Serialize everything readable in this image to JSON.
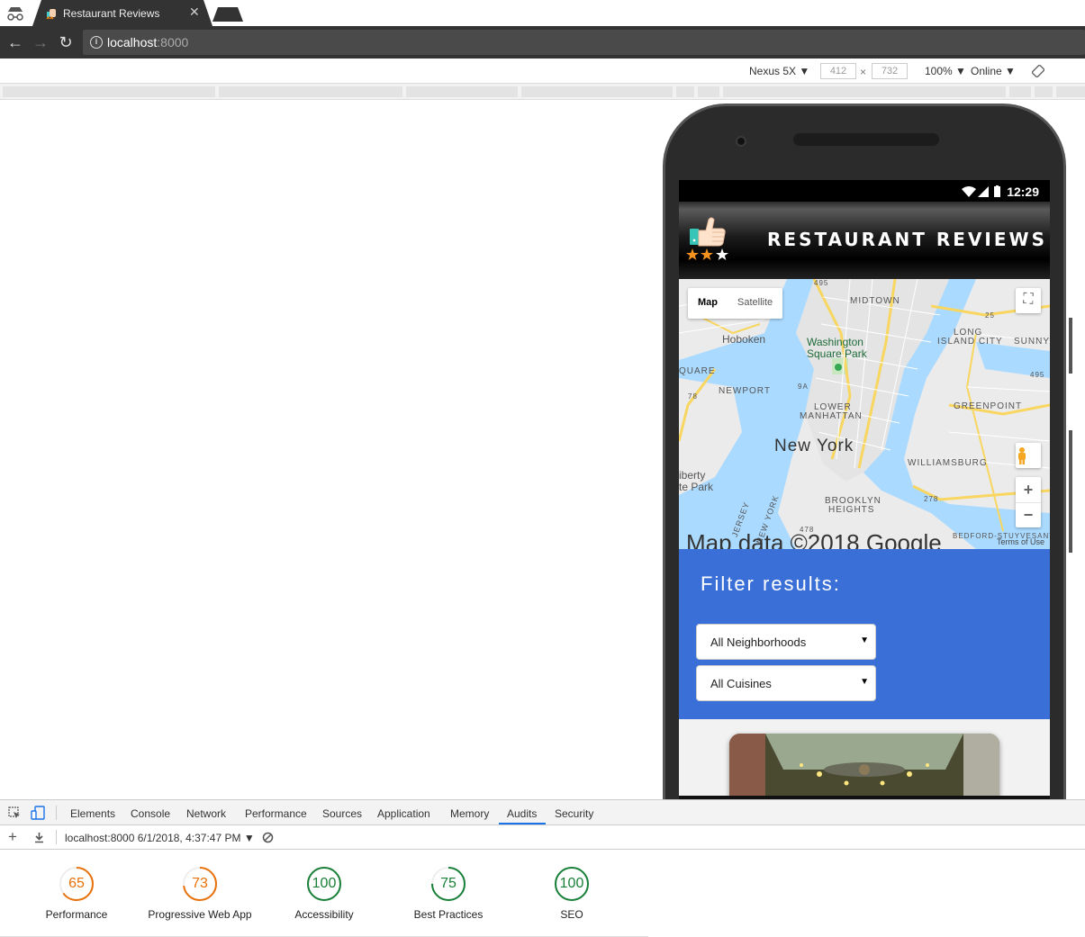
{
  "browser": {
    "tab_title": "Restaurant Reviews",
    "tab_close": "✕",
    "url_host": "localhost",
    "url_port": ":8000"
  },
  "device_toolbar": {
    "device": "Nexus 5X",
    "width": "412",
    "height": "732",
    "times": "×",
    "zoom": "100%",
    "network": "Online"
  },
  "phone": {
    "time": "12:29"
  },
  "site": {
    "title": "RESTAURANT REVIEWS"
  },
  "map": {
    "type_map": "Map",
    "type_satellite": "Satellite",
    "labels": {
      "midtown": "MIDTOWN",
      "hoboken": "Hoboken",
      "washington_sq": "Washington",
      "washington_sq2": "Square Park",
      "long_island": "LONG",
      "long_island2": "ISLAND CITY",
      "sunny": "SUNNY",
      "quare": "QUARE",
      "newport": "NEWPORT",
      "greenpoint": "GREENPOINT",
      "lower_manhattan": "LOWER",
      "lower_manhattan2": "MANHATTAN",
      "new_york": "New York",
      "williamsburg": "WILLIAMSBURG",
      "liberty": "iberty",
      "liberty2": "te Park",
      "brooklyn": "BROOKLYN",
      "brooklyn2": "HEIGHTS",
      "jersey": "JERSEY",
      "newyork_small": "NEW YORK",
      "bedford": "BEDFORD-STUYVESANT",
      "r495": "495",
      "r25": "25",
      "r495b": "495",
      "r78": "78",
      "r9a": "9A",
      "r278": "278",
      "r478": "478"
    },
    "attribution": "Map data ©2018 Google",
    "terms": "Terms of Use",
    "zoom_in": "+",
    "zoom_out": "−"
  },
  "filter": {
    "heading": "Filter results:",
    "neighborhood": "All Neighborhoods",
    "cuisine": "All Cuisines",
    "arrow": "▼"
  },
  "devtools": {
    "tabs": [
      "Elements",
      "Console",
      "Network",
      "Performance",
      "Sources",
      "Application",
      "Memory",
      "Audits",
      "Security"
    ],
    "report": "localhost:8000 6/1/2018, 4:37:47 PM",
    "scores": [
      {
        "value": "65",
        "label": "Performance",
        "color": "#e8710a",
        "pct": 0.65
      },
      {
        "value": "73",
        "label": "Progressive Web App",
        "color": "#e8710a",
        "pct": 0.73
      },
      {
        "value": "100",
        "label": "Accessibility",
        "color": "#188038",
        "pct": 1.0
      },
      {
        "value": "75",
        "label": "Best Practices",
        "color": "#188038",
        "pct": 0.75
      },
      {
        "value": "100",
        "label": "SEO",
        "color": "#188038",
        "pct": 1.0
      }
    ]
  },
  "colors": {
    "filter_bg": "#3a6fd8",
    "water": "#aadaff",
    "land": "#ebebeb",
    "road": "#f8d660"
  }
}
